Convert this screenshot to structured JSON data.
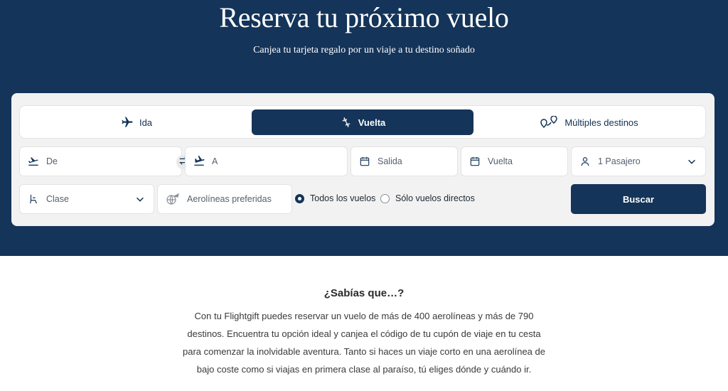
{
  "hero": {
    "title": "Reserva tu próximo vuelo",
    "subtitle": "Canjea tu tarjeta regalo por un viaje a tu destino soñado"
  },
  "tabs": [
    {
      "label": "Ida",
      "icon": "plane-icon",
      "active": false
    },
    {
      "label": "Vuelta",
      "icon": "round-trip-plane-icon",
      "active": true
    },
    {
      "label": "Múltiples destinos",
      "icon": "multi-pin-icon",
      "active": false
    }
  ],
  "fields": {
    "origin": {
      "placeholder": "De",
      "icon": "takeoff-icon"
    },
    "destination": {
      "placeholder": "A",
      "icon": "landing-icon"
    },
    "departure": {
      "placeholder": "Salida",
      "icon": "calendar-icon"
    },
    "return": {
      "placeholder": "Vuelta",
      "icon": "calendar-icon"
    },
    "passengers": {
      "value": "1 Pasajero",
      "icon": "person-icon"
    },
    "class": {
      "placeholder": "Clase",
      "icon": "seat-icon"
    },
    "airlines": {
      "placeholder": "Aerolíneas preferidas",
      "icon": "globe-plane-icon"
    }
  },
  "filters": [
    {
      "label": "Todos los vuelos",
      "selected": true
    },
    {
      "label": "Sólo vuelos directos",
      "selected": false
    }
  ],
  "search_label": "Buscar",
  "info": {
    "title": "¿Sabías que…?",
    "text": "Con tu Flightgift puedes reservar un vuelo de más de 400 aerolíneas y más de 790 destinos. Encuentra tu opción ideal y canjea el código de tu cupón de viaje en tu cesta para comenzar la inolvidable aventura. Tanto si haces un viaje corto en una aerolínea de bajo coste como si viajas en primera clase al paraíso, tú eliges dónde y cuándo ir."
  },
  "colors": {
    "brand": "#143459",
    "card": "#f2f2f2"
  }
}
